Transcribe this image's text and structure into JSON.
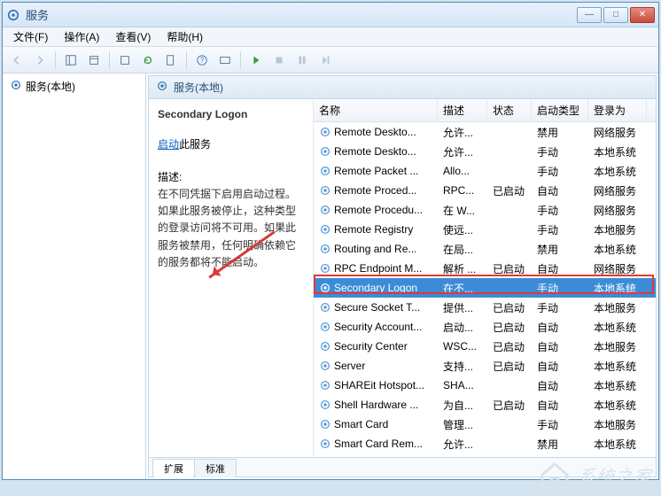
{
  "window": {
    "title": "服务"
  },
  "menu": {
    "file": "文件(F)",
    "action": "操作(A)",
    "view": "查看(V)",
    "help": "帮助(H)"
  },
  "tree": {
    "root": "服务(本地)"
  },
  "pane_header": "服务(本地)",
  "detail": {
    "service_name": "Secondary Logon",
    "action_link": "启动",
    "action_suffix": "此服务",
    "desc_label": "描述:",
    "desc_text": "在不同凭据下启用启动过程。如果此服务被停止，这种类型的登录访问将不可用。如果此服务被禁用，任何明确依赖它的服务都将不能启动。"
  },
  "columns": {
    "name": "名称",
    "desc": "描述",
    "status": "状态",
    "start": "启动类型",
    "logon": "登录为"
  },
  "services": [
    {
      "name": "Remote Deskto...",
      "desc": "允许...",
      "status": "",
      "start": "禁用",
      "logon": "网络服务"
    },
    {
      "name": "Remote Deskto...",
      "desc": "允许...",
      "status": "",
      "start": "手动",
      "logon": "本地系统"
    },
    {
      "name": "Remote Packet ...",
      "desc": "Allo...",
      "status": "",
      "start": "手动",
      "logon": "本地系统"
    },
    {
      "name": "Remote Proced...",
      "desc": "RPC...",
      "status": "已启动",
      "start": "自动",
      "logon": "网络服务"
    },
    {
      "name": "Remote Procedu...",
      "desc": "在 W...",
      "status": "",
      "start": "手动",
      "logon": "网络服务"
    },
    {
      "name": "Remote Registry",
      "desc": "使远...",
      "status": "",
      "start": "手动",
      "logon": "本地服务"
    },
    {
      "name": "Routing and Re...",
      "desc": "在局...",
      "status": "",
      "start": "禁用",
      "logon": "本地系统"
    },
    {
      "name": "RPC Endpoint M...",
      "desc": "解析 ...",
      "status": "已启动",
      "start": "自动",
      "logon": "网络服务"
    },
    {
      "name": "Secondary Logon",
      "desc": "在不...",
      "status": "",
      "start": "手动",
      "logon": "本地系统",
      "selected": true
    },
    {
      "name": "Secure Socket T...",
      "desc": "提供...",
      "status": "已启动",
      "start": "手动",
      "logon": "本地服务"
    },
    {
      "name": "Security Account...",
      "desc": "启动...",
      "status": "已启动",
      "start": "自动",
      "logon": "本地系统"
    },
    {
      "name": "Security Center",
      "desc": "WSC...",
      "status": "已启动",
      "start": "自动",
      "logon": "本地服务"
    },
    {
      "name": "Server",
      "desc": "支持...",
      "status": "已启动",
      "start": "自动",
      "logon": "本地系统"
    },
    {
      "name": "SHAREit Hotspot...",
      "desc": "SHA...",
      "status": "",
      "start": "自动",
      "logon": "本地系统"
    },
    {
      "name": "Shell Hardware ...",
      "desc": "为自...",
      "status": "已启动",
      "start": "自动",
      "logon": "本地系统"
    },
    {
      "name": "Smart Card",
      "desc": "管理...",
      "status": "",
      "start": "手动",
      "logon": "本地服务"
    },
    {
      "name": "Smart Card Rem...",
      "desc": "允许...",
      "status": "",
      "start": "禁用",
      "logon": "本地系统"
    }
  ],
  "tabs": {
    "extended": "扩展",
    "standard": "标准"
  },
  "watermark": "系统之家"
}
